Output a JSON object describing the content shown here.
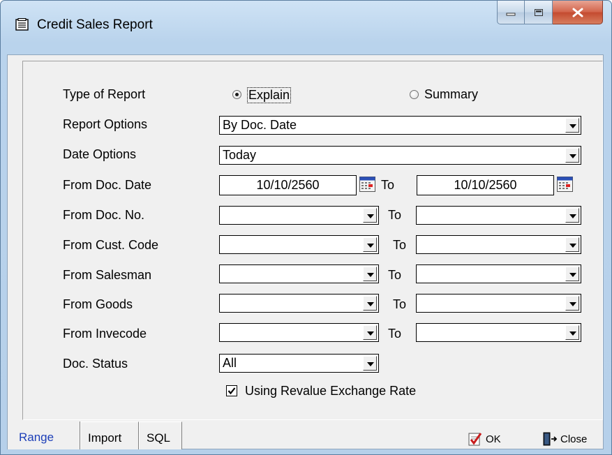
{
  "window": {
    "title": "Credit Sales Report"
  },
  "form": {
    "type_of_report": {
      "label": "Type of Report",
      "options": [
        "Explain",
        "Summary"
      ],
      "selected": "Explain"
    },
    "report_options": {
      "label": "Report Options",
      "value": "By Doc. Date"
    },
    "date_options": {
      "label": "Date Options",
      "value": "Today"
    },
    "from_doc_date": {
      "label": "From Doc. Date",
      "from": "10/10/2560",
      "to_label": "To",
      "to": "10/10/2560"
    },
    "from_doc_no": {
      "label": "From Doc. No.",
      "from": "",
      "to_label": "To",
      "to": ""
    },
    "from_cust_code": {
      "label": "From Cust. Code",
      "from": "",
      "to_label": "To",
      "to": ""
    },
    "from_salesman": {
      "label": "From Salesman",
      "from": "",
      "to_label": "To",
      "to": ""
    },
    "from_goods": {
      "label": "From Goods",
      "from": "",
      "to_label": "To",
      "to": ""
    },
    "from_invecode": {
      "label": "From Invecode",
      "from": "",
      "to_label": "To",
      "to": ""
    },
    "doc_status": {
      "label": "Doc. Status",
      "value": "All"
    },
    "revalue": {
      "label": "Using Revalue Exchange Rate",
      "checked": true
    }
  },
  "bottom": {
    "tabs": [
      "Range",
      "Import",
      "SQL"
    ],
    "active_tab": "Range",
    "ok_label": "OK",
    "close_label": "Close"
  },
  "colors": {
    "active_tab_text": "#1d3fb8",
    "close_button": "#c44a2f"
  }
}
